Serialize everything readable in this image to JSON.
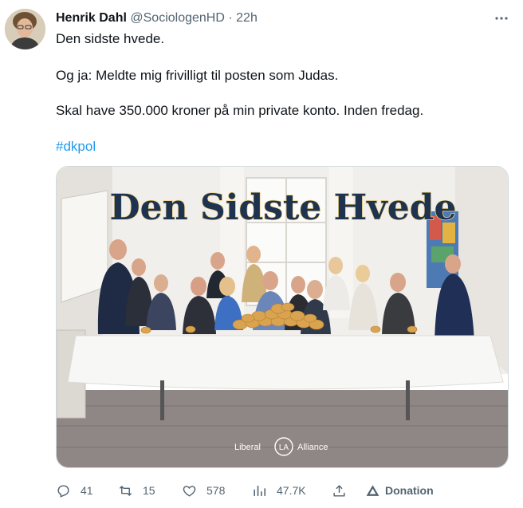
{
  "tweet": {
    "author_name": "Henrik Dahl",
    "handle": "@SociologenHD",
    "separator": "·",
    "time": "22h",
    "more_glyph": "•••",
    "lines": [
      "Den sidste hvede.",
      "Og ja: Meldte mig frivilligt til posten som Judas.",
      "Skal have 350.000 kroner på min private konto. Inden fredag."
    ],
    "hashtag": "#dkpol"
  },
  "media": {
    "overlay_title": "Den Sidste Hvede",
    "logo_left": "Liberal",
    "logo_mark": "LA",
    "logo_right": "Alliance"
  },
  "actions": {
    "replies": "41",
    "retweets": "15",
    "likes": "578",
    "views": "47.7K",
    "donation_label": "Donation"
  },
  "colors": {
    "text": "#0f1419",
    "secondary": "#536471",
    "link": "#1d9bf0",
    "title_fill": "#1e3350",
    "title_outline": "#f2d58a"
  }
}
